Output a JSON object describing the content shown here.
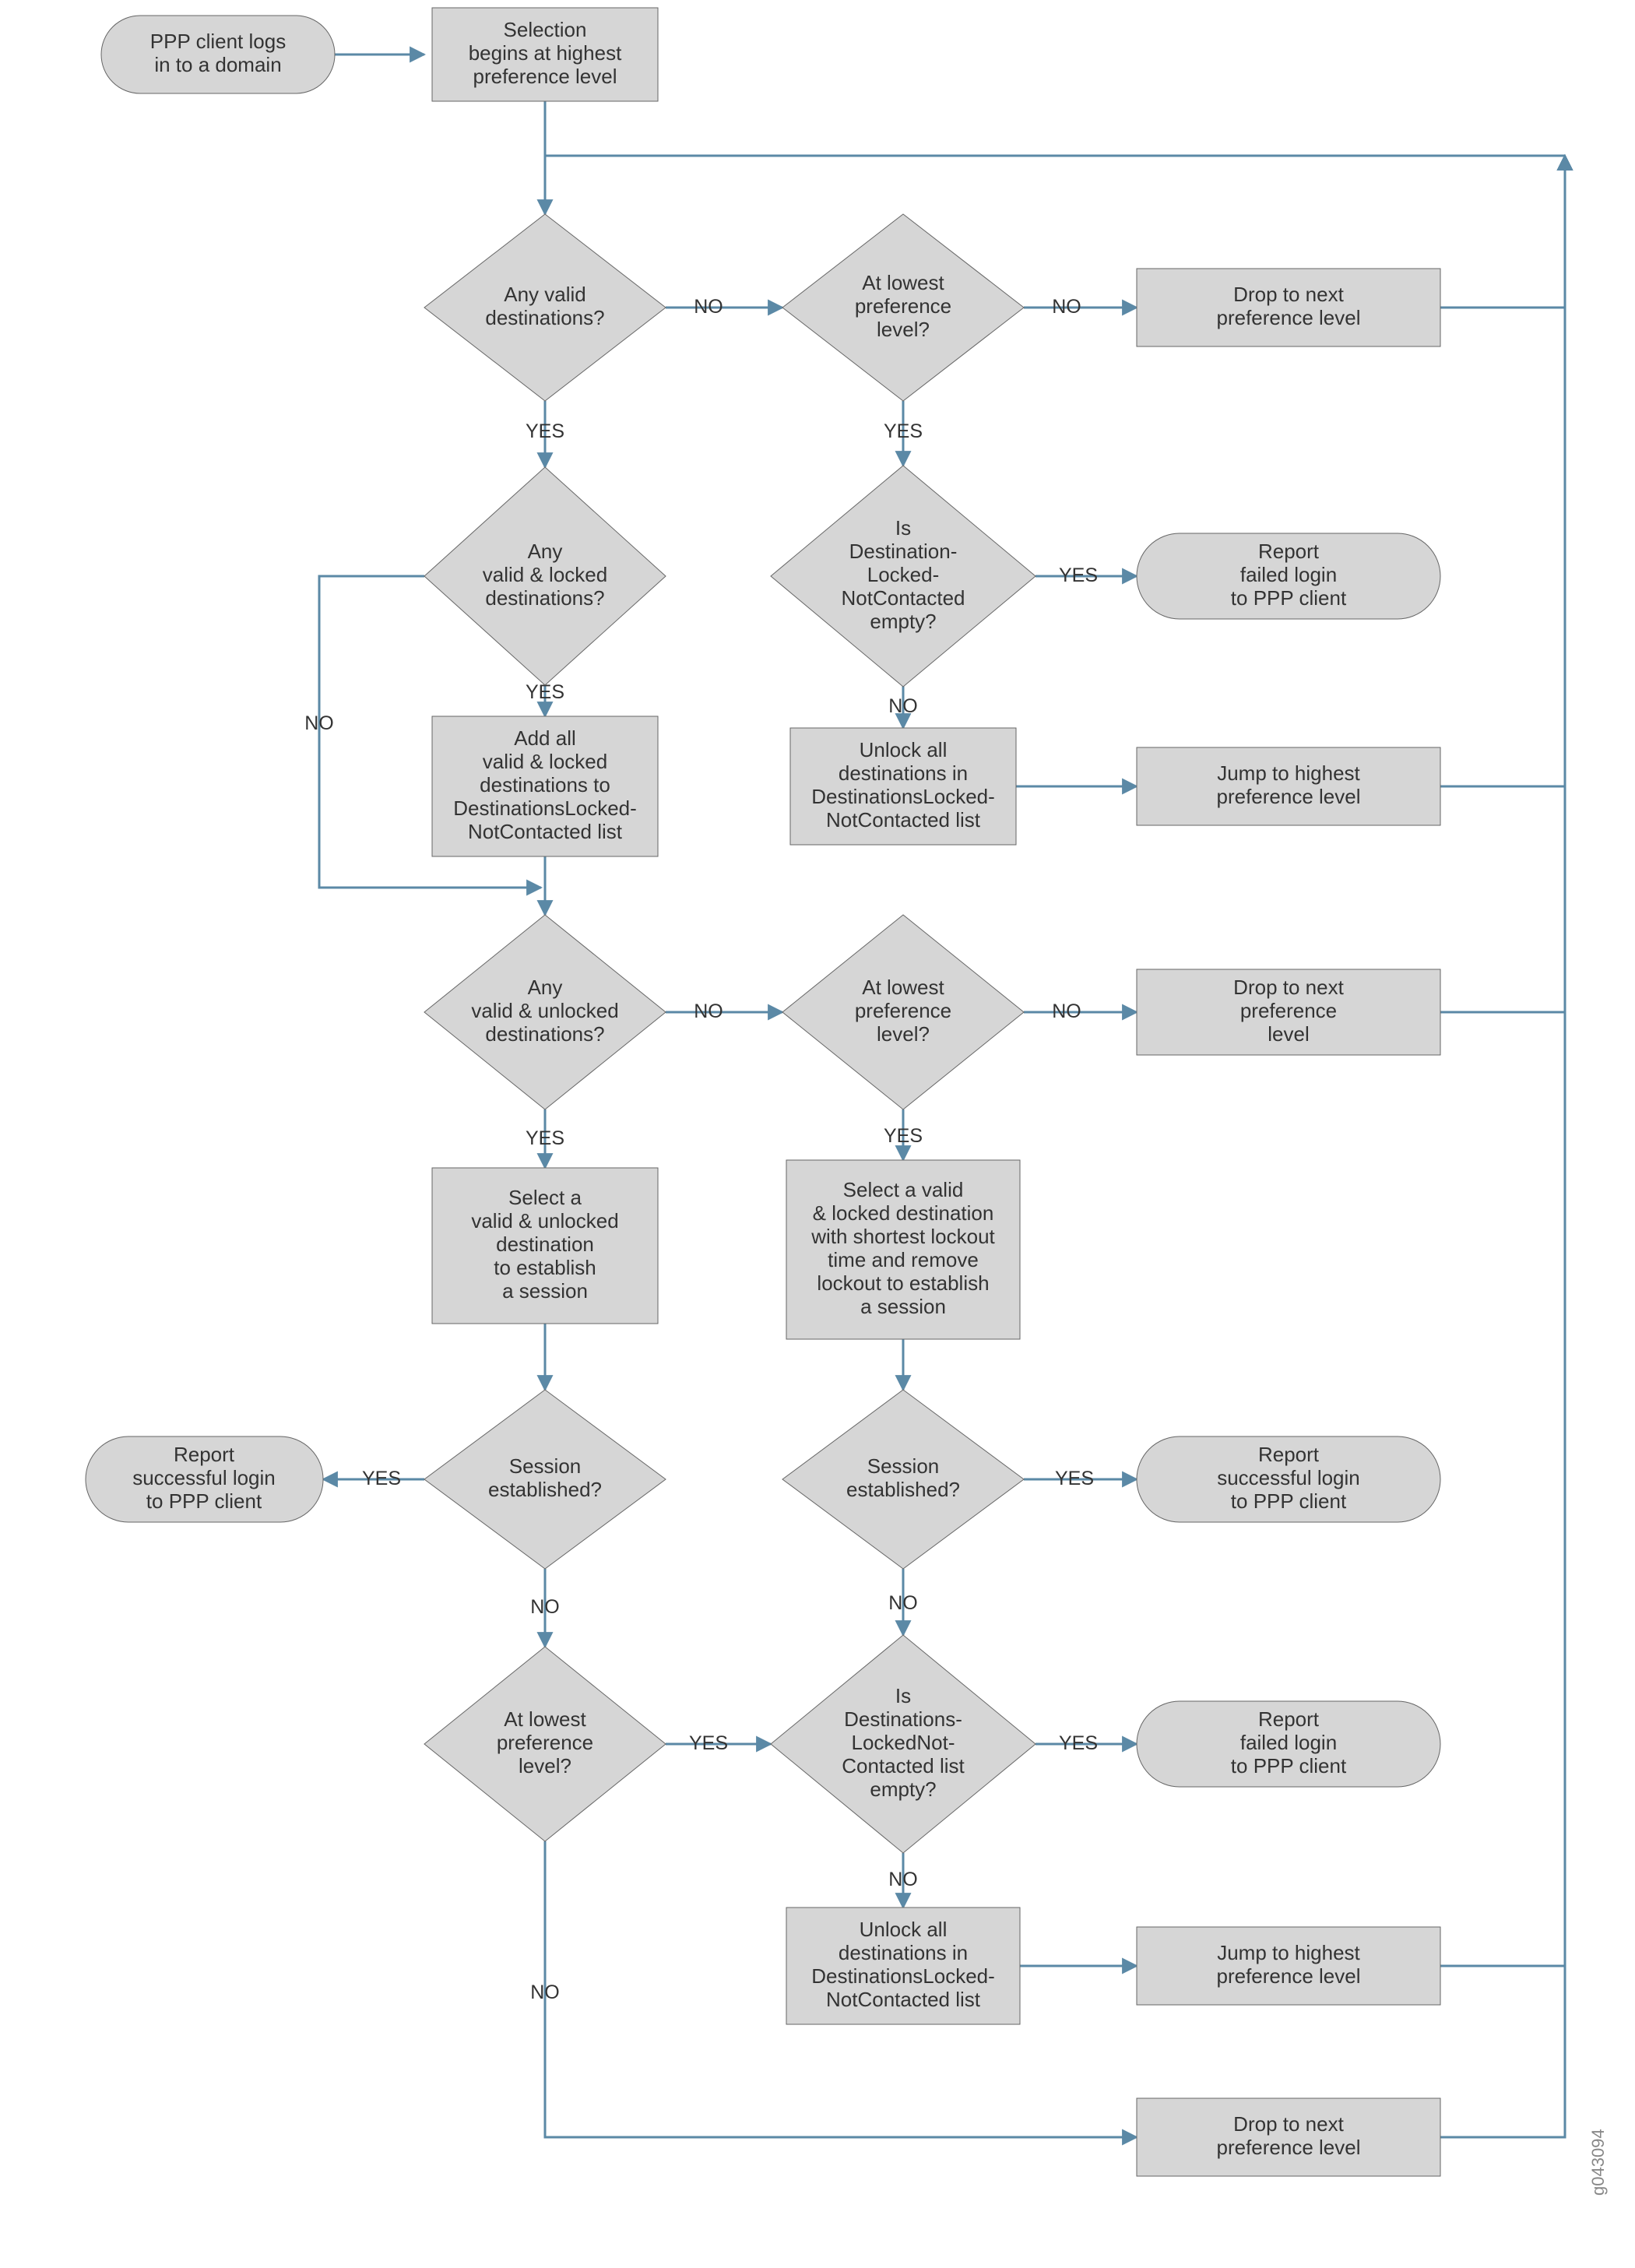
{
  "chart_data": {
    "type": "flowchart",
    "title": "PPP client destination selection flow",
    "edge_labels": [
      "YES",
      "NO"
    ]
  },
  "nodes": {
    "start": "PPP client logs\nin to a domain",
    "sel_begin": "Selection\nbegins at highest\npreference level",
    "d_any_valid": "Any valid\ndestinations?",
    "d_lowest1": "At lowest\npreference\nlevel?",
    "p_drop1": "Drop to next\npreference level",
    "d_any_locked": "Any\nvalid & locked\ndestinations?",
    "d_dlnc_empty1": "Is\nDestination-\nLocked-\nNotContacted\nempty?",
    "t_fail1": "Report\nfailed login\nto PPP client",
    "p_addall": "Add all\nvalid & locked\ndestinations to\nDestinationsLocked-\nNotContacted list",
    "p_unlock1": "Unlock all\ndestinations in\nDestinationsLocked-\nNotContacted list",
    "p_jump1": "Jump to highest\npreference level",
    "d_any_unlocked": "Any\nvalid & unlocked\ndestinations?",
    "d_lowest2": "At lowest\npreference\nlevel?",
    "p_drop2": "Drop to next\npreference\nlevel",
    "p_sel_unlock": "Select a\nvalid & unlocked\ndestination\nto establish\na session",
    "p_sel_lock": "Select a valid\n& locked destination\nwith shortest lockout\ntime and remove\nlockout to establish\na session",
    "t_succ1": "Report\nsuccessful login\nto PPP client",
    "d_sess1": "Session\nestablished?",
    "d_sess2": "Session\nestablished?",
    "t_succ2": "Report\nsuccessful login\nto PPP client",
    "d_lowest3": "At lowest\npreference\nlevel?",
    "d_dlnc_empty2": "Is\nDestinations-\nLockedNot-\nContacted list\nempty?",
    "t_fail2": "Report\nfailed login\nto PPP client",
    "p_unlock2": "Unlock all\ndestinations in\nDestinationsLocked-\nNotContacted list",
    "p_jump2": "Jump to highest\npreference level",
    "p_drop3": "Drop to next\npreference level"
  },
  "labels": {
    "yes": "YES",
    "no": "NO"
  },
  "image_id": "g043094"
}
